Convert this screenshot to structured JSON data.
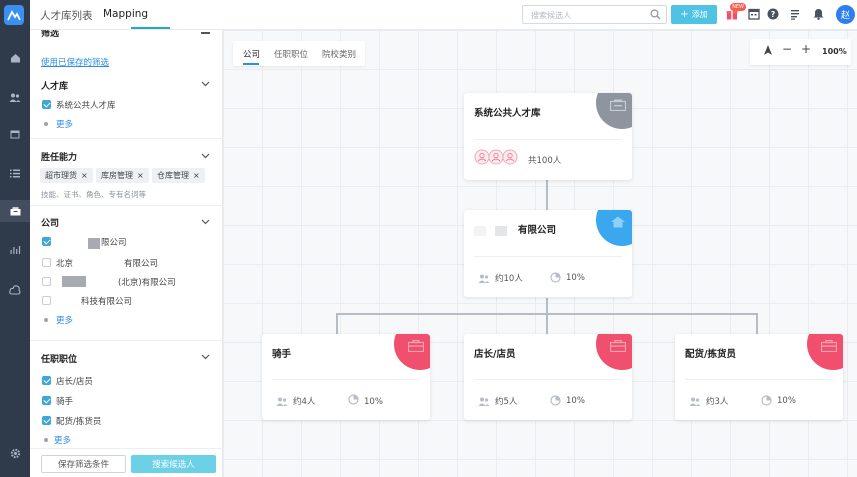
{
  "header": {
    "tabs": [
      {
        "label": "人才库列表",
        "active": false
      },
      {
        "label": "Mapping",
        "active": true
      }
    ],
    "search": {
      "placeholder": "搜索候选人"
    },
    "add_label": "添加",
    "new_badge": "NEW",
    "avatar_text": "赵",
    "icons": [
      "gift-icon",
      "calendar-icon",
      "help-icon",
      "document-icon",
      "bell-icon"
    ]
  },
  "rail": {
    "icons": [
      "logo-icon",
      "home-icon",
      "people-icon",
      "calendar-icon",
      "list-icon",
      "talent-pool-icon",
      "chart-icon",
      "cloud-icon",
      "settings-icon"
    ],
    "active": "talent-pool-icon"
  },
  "filters": {
    "title": "筛选",
    "use_saved": "使用已保存的筛选",
    "pool": {
      "title": "人才库",
      "items": [
        {
          "label": "系统公共人才库",
          "checked": true
        }
      ],
      "more": "更多"
    },
    "competency": {
      "title": "胜任能力",
      "tags": [
        "超市理货",
        "库房管理",
        "仓库管理"
      ],
      "hint": "技能、证书、角色、专有名词等"
    },
    "company": {
      "title": "公司",
      "items": [
        {
          "label": "限公司",
          "checked": true
        },
        {
          "label": "北京",
          "label2": "有限公司",
          "checked": false
        },
        {
          "label": "(北京)有限公司",
          "checked": false
        },
        {
          "label": "科技有限公司",
          "checked": false
        }
      ],
      "more": "更多"
    },
    "position": {
      "title": "任职职位",
      "items": [
        {
          "label": "店长/店员",
          "checked": true
        },
        {
          "label": "骑手",
          "checked": true
        },
        {
          "label": "配货/拣货员",
          "checked": true
        }
      ],
      "more": "更多"
    },
    "save_button": "保存筛选条件",
    "search_button": "搜索候选人"
  },
  "canvas": {
    "tabs": [
      {
        "label": "公司",
        "active": true
      },
      {
        "label": "任职职位",
        "active": false
      },
      {
        "label": "院校类别",
        "active": false
      }
    ],
    "zoom": "100%",
    "root": {
      "title": "系统公共人才库",
      "count": "共100人",
      "color": "#8e959e"
    },
    "company": {
      "title": "有限公司",
      "people": "约10人",
      "percent": "10%",
      "color": "#3aa7ef"
    },
    "positions": [
      {
        "title": "骑手",
        "people": "约4人",
        "percent": "10%",
        "color": "#f0506e"
      },
      {
        "title": "店长/店员",
        "people": "约5人",
        "percent": "10%",
        "color": "#f0506e"
      },
      {
        "title": "配货/拣货员",
        "people": "约3人",
        "percent": "10%",
        "color": "#f0506e"
      }
    ]
  }
}
